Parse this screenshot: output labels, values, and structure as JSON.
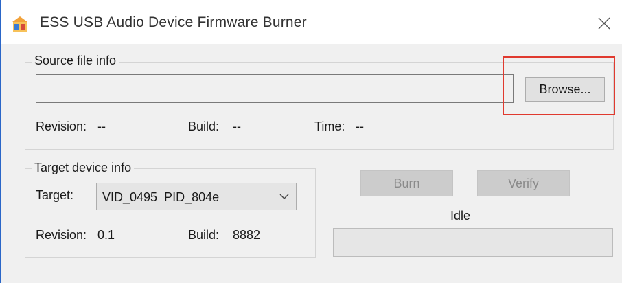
{
  "window": {
    "title": "ESS USB Audio Device Firmware Burner",
    "icon": "ess-app-icon",
    "close_icon": "close-x-icon"
  },
  "source": {
    "legend": "Source file info",
    "path_value": "",
    "browse_label": "Browse...",
    "revision_label": "Revision:",
    "revision_value": "--",
    "build_label": "Build:",
    "build_value": "--",
    "time_label": "Time:",
    "time_value": "--"
  },
  "target": {
    "legend": "Target device info",
    "target_label": "Target:",
    "selected": "VID_0495  PID_804e",
    "revision_label": "Revision:",
    "revision_value": "0.1",
    "build_label": "Build:",
    "build_value": "8882"
  },
  "actions": {
    "burn_label": "Burn",
    "verify_label": "Verify",
    "status": "Idle",
    "progress": 0
  },
  "colors": {
    "highlight": "#e03a2f",
    "window_border": "#2a66c8"
  }
}
